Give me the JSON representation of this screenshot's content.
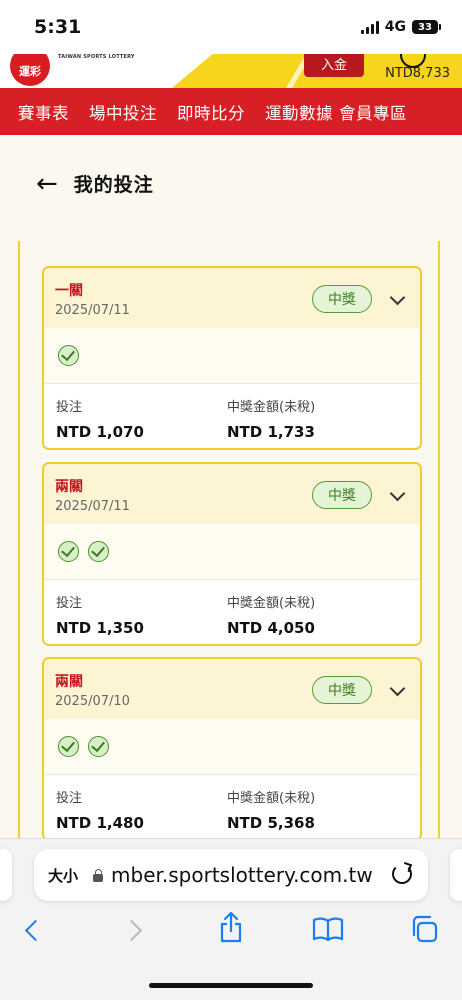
{
  "status_bar": {
    "time": "5:31",
    "network": "4G",
    "battery": "33"
  },
  "site_header": {
    "logo_text": "運彩",
    "logo_subtitle": "TAIWAN SPORTS LOTTERY",
    "deposit_label": "入金",
    "balance": "NTD8,733"
  },
  "nav": {
    "items": [
      "賽事表",
      "場中投注",
      "即時比分",
      "運動數據",
      "會員專區"
    ]
  },
  "page": {
    "back_glyph": "←",
    "title": "我的投注"
  },
  "bets": [
    {
      "type": "一關",
      "date": "2025/07/11",
      "status": "中獎",
      "checks": 1,
      "stake_label": "投注",
      "stake": "NTD 1,070",
      "payout_label": "中獎金額(未稅)",
      "payout": "NTD 1,733"
    },
    {
      "type": "兩關",
      "date": "2025/07/11",
      "status": "中獎",
      "checks": 2,
      "stake_label": "投注",
      "stake": "NTD 1,350",
      "payout_label": "中獎金額(未稅)",
      "payout": "NTD 4,050"
    },
    {
      "type": "兩關",
      "date": "2025/07/10",
      "status": "中獎",
      "checks": 2,
      "stake_label": "投注",
      "stake": "NTD 1,480",
      "payout_label": "中獎金額(未稅)",
      "payout": "NTD 5,368"
    }
  ],
  "browser": {
    "text_size_label": "大小",
    "url": "mber.sportslottery.com.tw"
  },
  "colors": {
    "brand_red": "#d71f26",
    "accent_yellow": "#f0cd2a",
    "win_green": "#3e7d24",
    "link_blue": "#1c7cf5"
  }
}
